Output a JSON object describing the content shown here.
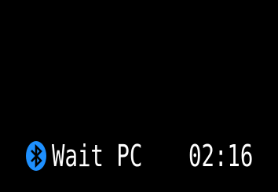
{
  "display": {
    "background": "#000000",
    "text_color": "#ffffff"
  },
  "status_bar": {
    "icon": "bluetooth-icon",
    "icon_color": "#1e90ff",
    "status_text": "Wait PC",
    "clock": "02:16"
  }
}
